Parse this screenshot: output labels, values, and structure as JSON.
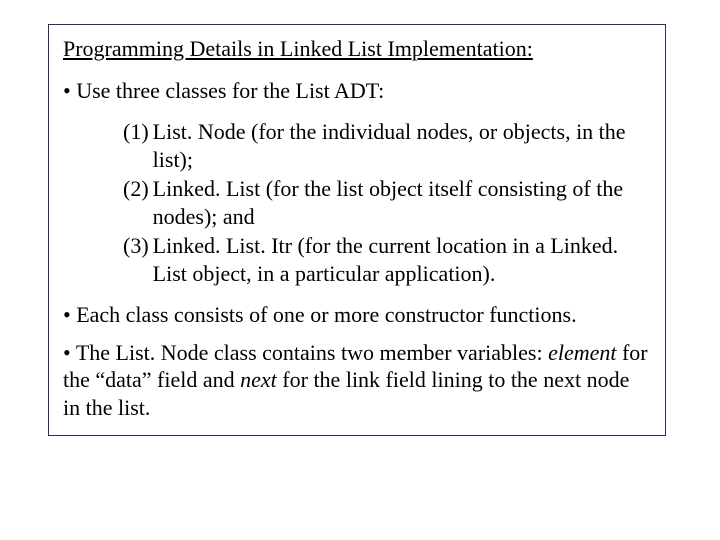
{
  "title": "Programming Details in Linked List Implementation:",
  "bullet1_prefix": "• ",
  "bullet1": "Use three classes for the List ADT:",
  "items": [
    {
      "num": "(1) ",
      "text": "List. Node (for the individual nodes, or objects, in the list);"
    },
    {
      "num": "(2) ",
      "text": "Linked. List (for the list object itself consisting of the nodes); and"
    },
    {
      "num": "(3) ",
      "text": "Linked. List. Itr (for the current location in a Linked. List object, in a particular application)."
    }
  ],
  "bullet2_prefix": "• ",
  "bullet2": "Each class consists of one or more constructor functions.",
  "bullet3_prefix": "• ",
  "bullet3_a": "The List. Node class contains two member variables: ",
  "bullet3_em1": "element",
  "bullet3_b": " for the “data” field and ",
  "bullet3_em2": "next",
  "bullet3_c": " for the link field lining to the next node in the list."
}
